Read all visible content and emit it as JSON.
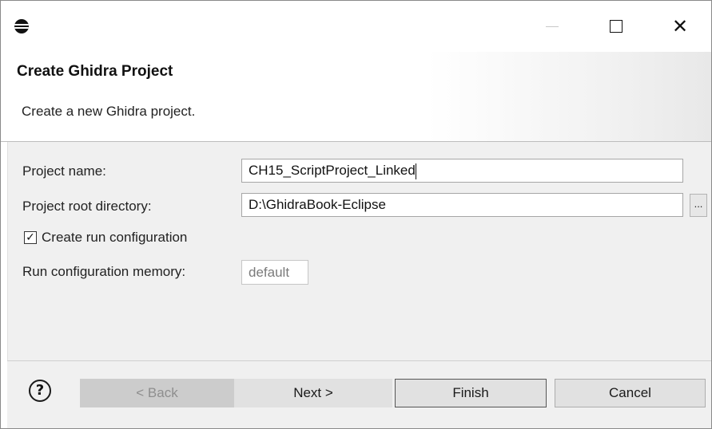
{
  "titlebar": {
    "app_icon": "eclipse-icon",
    "minimize_icon": "minimize-icon",
    "maximize_icon": "maximize-icon",
    "close_glyph": "✕"
  },
  "header": {
    "title": "Create Ghidra Project",
    "description": "Create a new Ghidra project."
  },
  "form": {
    "project_name_label": "Project name:",
    "project_name_value": "CH15_ScriptProject_Linked",
    "root_dir_label": "Project root directory:",
    "root_dir_value": "D:\\GhidraBook-Eclipse",
    "browse_label": "...",
    "run_config_label": "Create run configuration",
    "run_config_checked": true,
    "check_glyph": "✓",
    "memory_label": "Run configuration memory:",
    "memory_value": "default"
  },
  "footer": {
    "help_glyph": "?",
    "back_label": "< Back",
    "next_label": "Next >",
    "finish_label": "Finish",
    "cancel_label": "Cancel"
  }
}
